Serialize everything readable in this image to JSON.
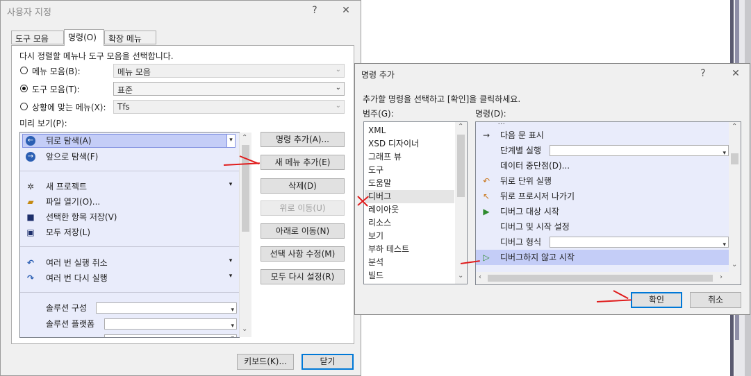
{
  "customize": {
    "title": "사용자 지정",
    "help": "?",
    "close": "✕",
    "tabs": [
      "도구 모음(S)",
      "명령(O)",
      "확장 메뉴(E)"
    ],
    "instruction": "다시 정렬할 메뉴나 도구 모음을 선택합니다.",
    "options": [
      {
        "label": "메뉴 모음(B):",
        "value": "메뉴 모음",
        "selected": false
      },
      {
        "label": "도구 모음(T):",
        "value": "표준",
        "selected": true
      },
      {
        "label": "상황에 맞는 메뉴(X):",
        "value": "Tfs",
        "selected": false
      }
    ],
    "preview_label": "미리 보기(P):",
    "preview_items": [
      {
        "label": "뒤로 탐색(A)",
        "icon": "back-circle-icon"
      },
      {
        "label": "앞으로 탐색(F)",
        "icon": "forward-circle-icon"
      },
      {
        "label": "새 프로젝트",
        "icon": "new-project-icon"
      },
      {
        "label": "파일 열기(O)...",
        "icon": "open-folder-icon"
      },
      {
        "label": "선택한 항목 저장(V)",
        "icon": "save-icon"
      },
      {
        "label": "모두 저장(L)",
        "icon": "save-all-icon"
      },
      {
        "label": "여러 번 실행 취소",
        "icon": "undo-icon"
      },
      {
        "label": "여러 번 다시 실행",
        "icon": "redo-icon"
      },
      {
        "label": "솔루션 구성",
        "icon": ""
      },
      {
        "label": "솔루션 플랫폼",
        "icon": ""
      }
    ],
    "buttons": {
      "add_command": "명령 추가(A)...",
      "add_menu": "새 메뉴 추가(E)",
      "delete": "삭제(D)",
      "move_up": "위로 이동(U)",
      "move_down": "아래로 이동(N)",
      "modify_selection": "선택 사항 수정(M)",
      "reset_all": "모두 다시 설정(R)",
      "keyboard": "키보드(K)...",
      "close": "닫기"
    }
  },
  "add_command": {
    "title": "명령 추가",
    "help": "?",
    "close": "✕",
    "instruction": "추가할 명령을 선택하고 [확인]을 클릭하세요.",
    "categories_label": "범주(G):",
    "commands_label": "명령(D):",
    "categories": [
      "XML",
      "XSD 디자이너",
      "그래프 뷰",
      "도구",
      "도움말",
      "디버그",
      "레이아웃",
      "리소스",
      "보기",
      "부하 테스트",
      "분석",
      "빌드"
    ],
    "selected_category": "디버그",
    "commands": [
      {
        "label": "다음 문 표시",
        "icon": "arrow-right-icon"
      },
      {
        "label": "단계별 실행",
        "icon": ""
      },
      {
        "label": "데이터 중단점(D)...",
        "icon": ""
      },
      {
        "label": "뒤로 단위 실행",
        "icon": "step-back-icon"
      },
      {
        "label": "뒤로 프로시저 나가기",
        "icon": "step-out-back-icon"
      },
      {
        "label": "디버그 대상 시작",
        "icon": "play-icon"
      },
      {
        "label": "디버그 및 시작 설정",
        "icon": ""
      },
      {
        "label": "디버그 형식",
        "icon": ""
      },
      {
        "label": "디버그하지 않고 시작",
        "icon": "play-outline-icon"
      }
    ],
    "selected_command": "디버그하지 않고 시작",
    "ok": "확인",
    "cancel": "취소"
  }
}
